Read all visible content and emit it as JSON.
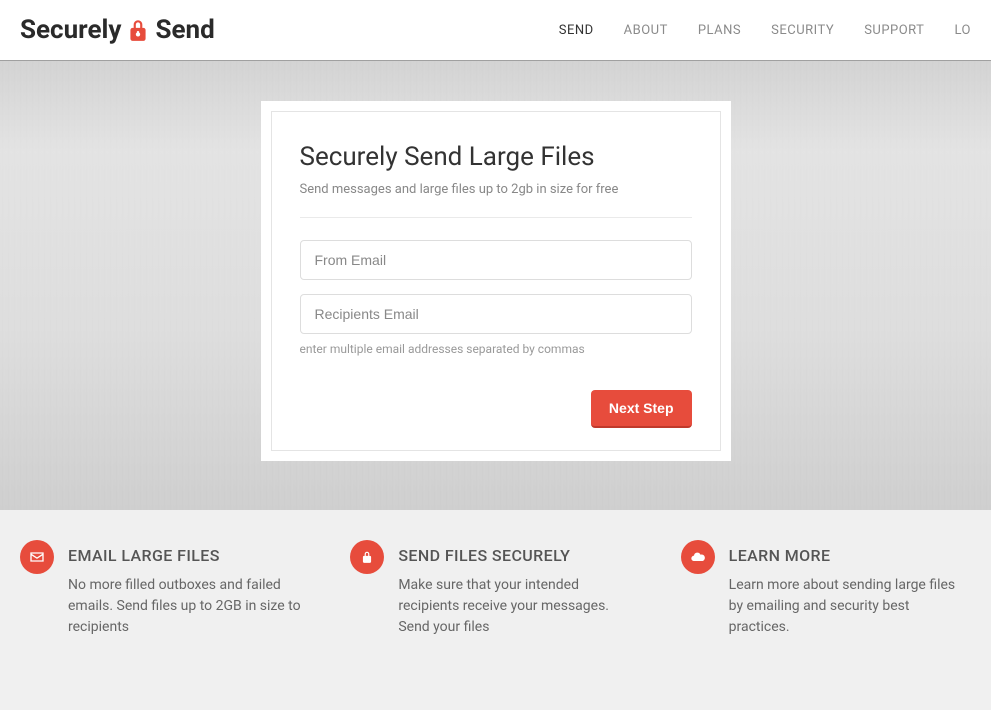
{
  "brand": {
    "part1": "Securely",
    "part2": "Send"
  },
  "nav": {
    "send": "SEND",
    "about": "ABOUT",
    "plans": "PLANS",
    "security": "SECURITY",
    "support": "SUPPORT",
    "login": "LO"
  },
  "card": {
    "title": "Securely Send Large Files",
    "subtitle": "Send messages and large files up to 2gb in size for free",
    "from_placeholder": "From Email",
    "recipients_placeholder": "Recipients Email",
    "hint": "enter multiple email addresses separated by commas",
    "next_button": "Next Step"
  },
  "features": [
    {
      "icon": "envelope-icon",
      "title": "EMAIL LARGE FILES",
      "body": "No more filled outboxes and failed emails. Send files up to 2GB in size to recipients"
    },
    {
      "icon": "lock-icon",
      "title": "SEND FILES SECURELY",
      "body": "Make sure that your intended recipients receive your messages. Send your files"
    },
    {
      "icon": "cloud-icon",
      "title": "LEARN MORE",
      "body": "Learn more about sending large files by emailing and security best practices."
    }
  ]
}
